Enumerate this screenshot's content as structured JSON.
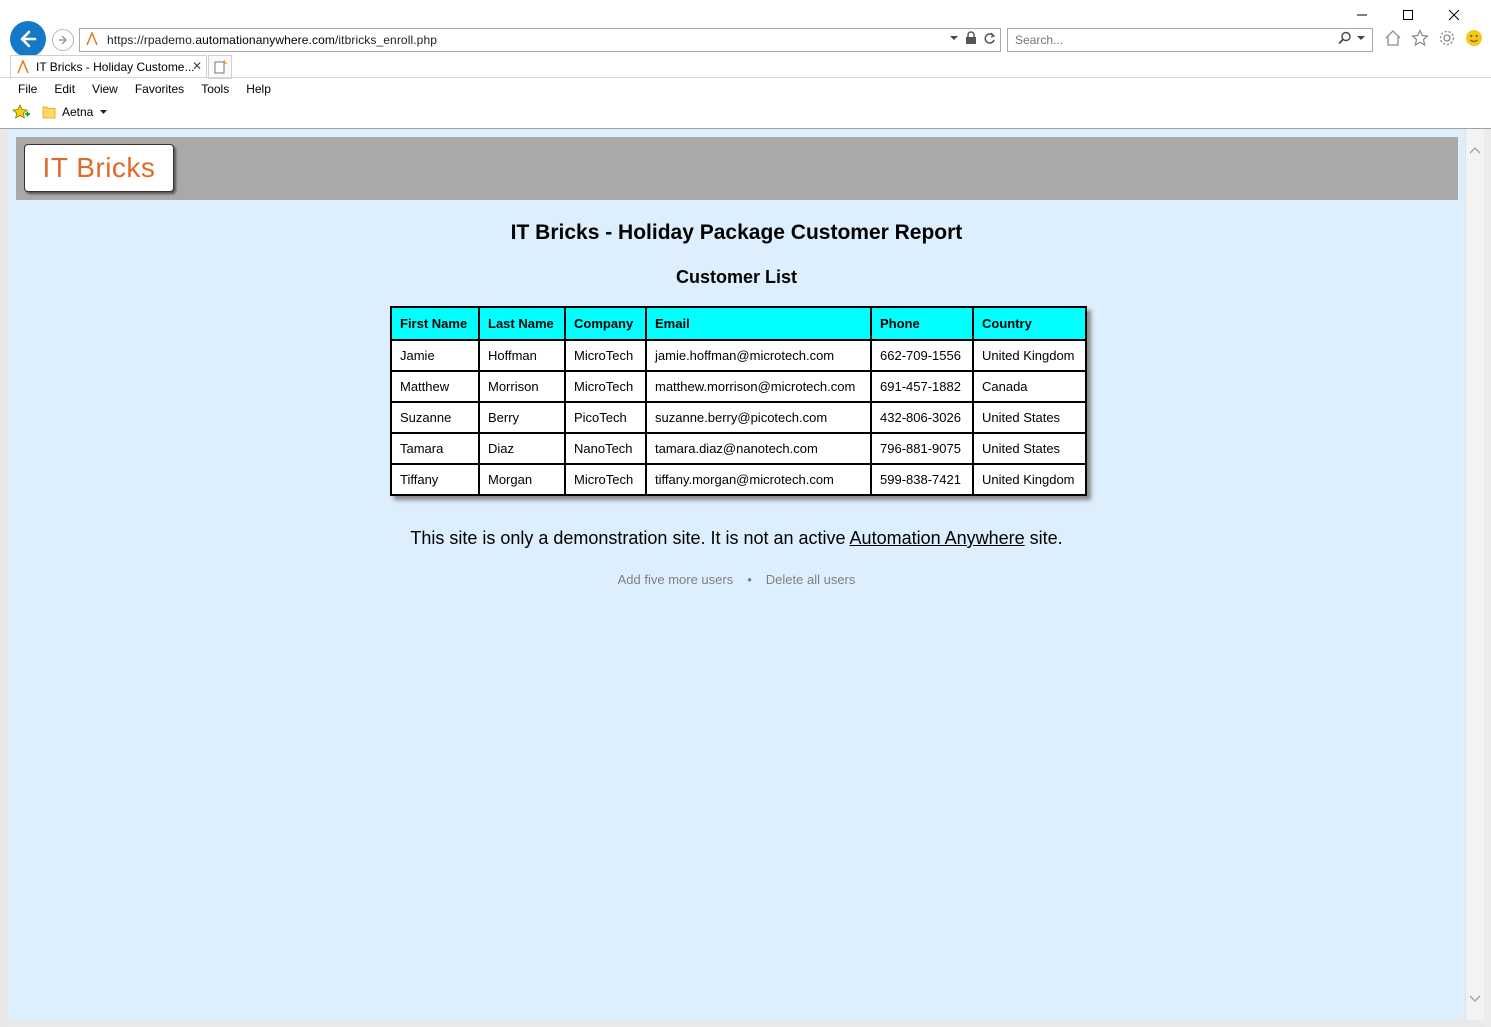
{
  "browser": {
    "url_prefix": "https://rpademo.",
    "url_domain": "automationanywhere.com",
    "url_path": "/itbricks_enroll.php",
    "search_placeholder": "Search...",
    "tab_title": "IT Bricks - Holiday Custome...",
    "menu": [
      "File",
      "Edit",
      "View",
      "Favorites",
      "Tools",
      "Help"
    ],
    "favorites_folder": "Aetna"
  },
  "page": {
    "logo_text": "IT Bricks",
    "title": "IT Bricks - Holiday Package Customer Report",
    "subtitle": "Customer List",
    "table": {
      "headers": [
        "First Name",
        "Last Name",
        "Company",
        "Email",
        "Phone",
        "Country"
      ],
      "rows": [
        [
          "Jamie",
          "Hoffman",
          "MicroTech",
          "jamie.hoffman@microtech.com",
          "662-709-1556",
          "United Kingdom"
        ],
        [
          "Matthew",
          "Morrison",
          "MicroTech",
          "matthew.morrison@microtech.com",
          "691-457-1882",
          "Canada"
        ],
        [
          "Suzanne",
          "Berry",
          "PicoTech",
          "suzanne.berry@picotech.com",
          "432-806-3026",
          "United States"
        ],
        [
          "Tamara",
          "Diaz",
          "NanoTech",
          "tamara.diaz@nanotech.com",
          "796-881-9075",
          "United States"
        ],
        [
          "Tiffany",
          "Morgan",
          "MicroTech",
          "tiffany.morgan@microtech.com",
          "599-838-7421",
          "United Kingdom"
        ]
      ]
    },
    "notice_before": "This site is only a demonstration site. It is not an active ",
    "notice_link": "Automation Anywhere",
    "notice_after": " site.",
    "action_add": "Add five more users",
    "action_separator": "•",
    "action_delete": "Delete all users"
  },
  "colors": {
    "header_cell": "#00ffff",
    "page_background": "#ddeefd",
    "banner": "#a9a9a9",
    "logo_text": "#e06a2a",
    "back_button": "#1479c9"
  }
}
